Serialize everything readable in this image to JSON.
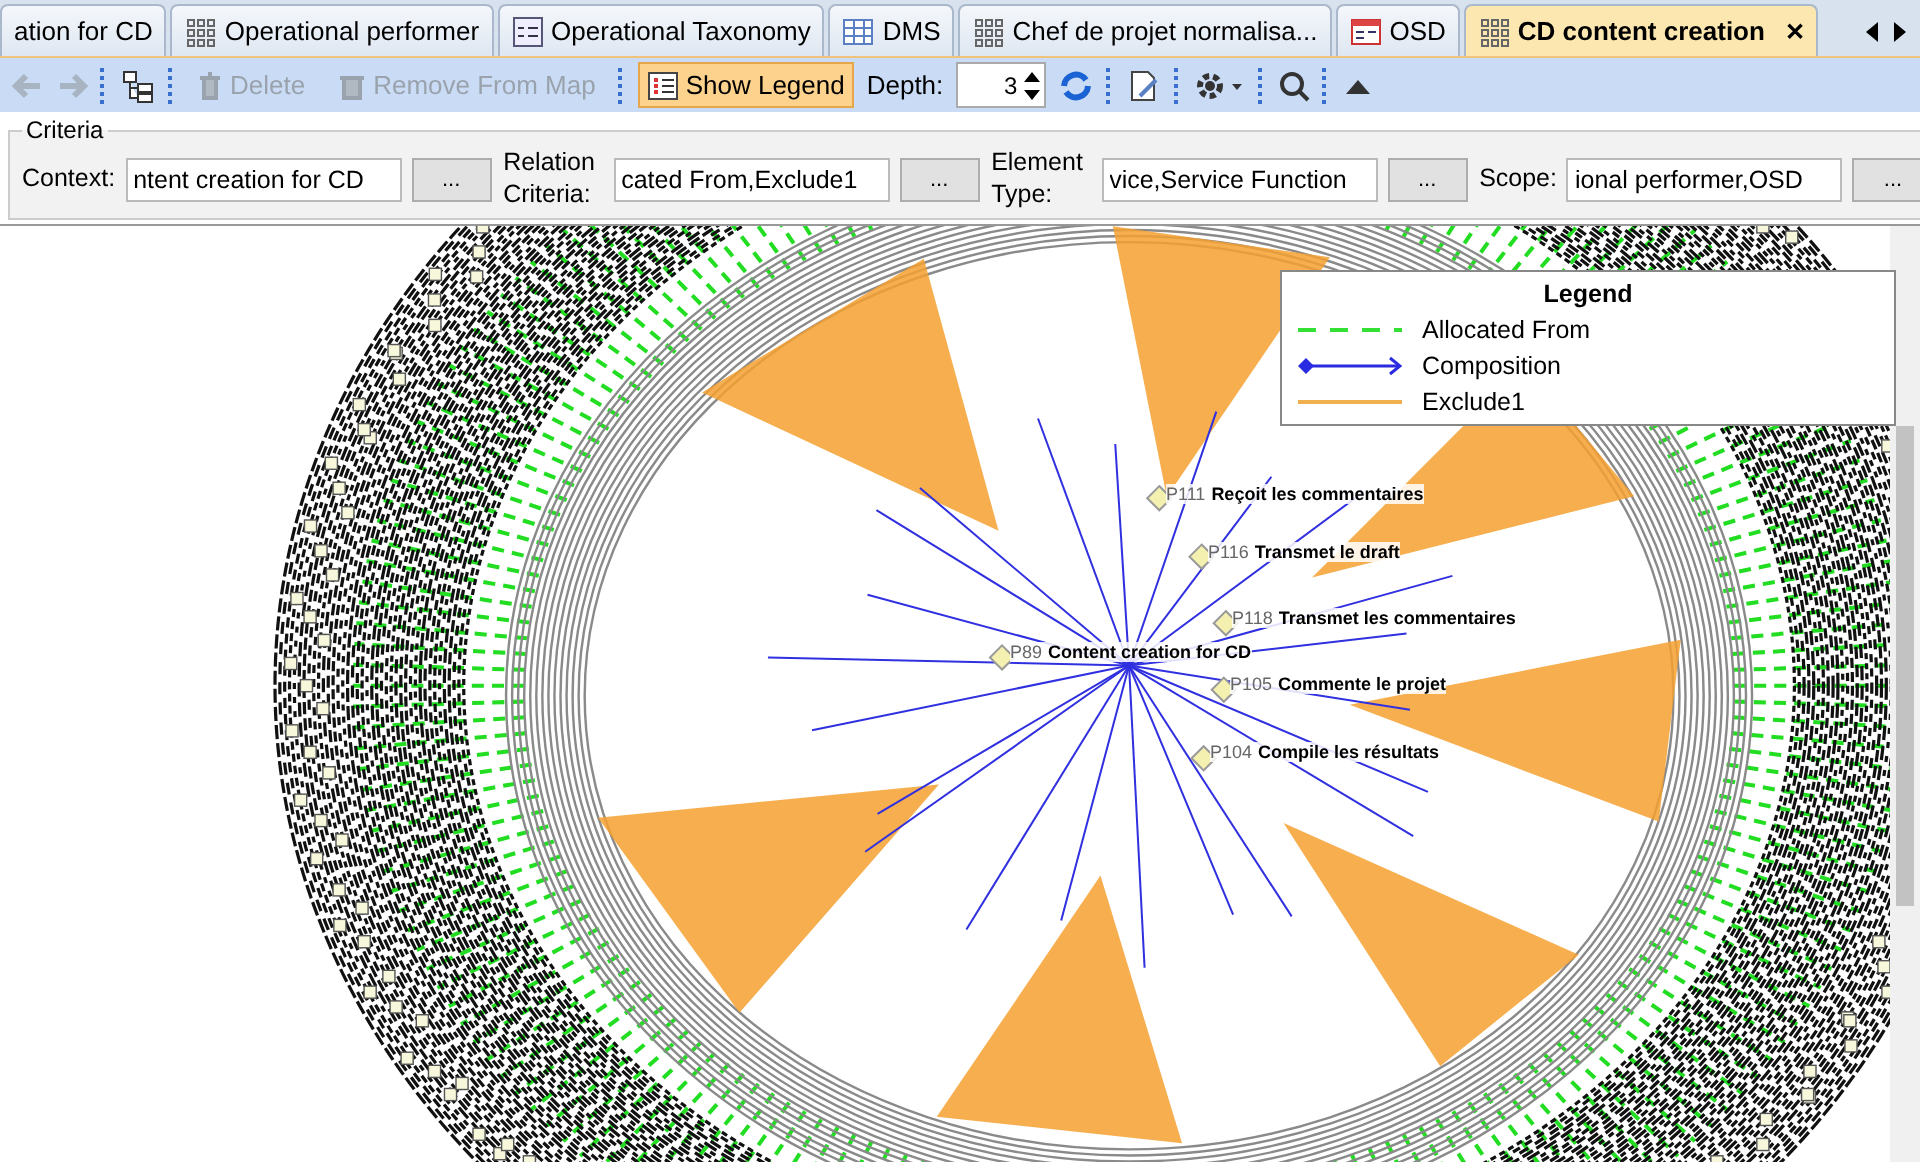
{
  "tabs": [
    {
      "label": "ation for CD",
      "selected": false
    },
    {
      "label": "Operational performer",
      "selected": false
    },
    {
      "label": "Operational Taxonomy",
      "selected": false
    },
    {
      "label": "DMS",
      "selected": false
    },
    {
      "label": "Chef de projet normalisa...",
      "selected": false
    },
    {
      "label": "OSD",
      "selected": false
    },
    {
      "label": "CD content creation",
      "selected": true,
      "close": "✕"
    }
  ],
  "toolbar": {
    "delete_label": "Delete",
    "remove_label": "Remove From Map",
    "legend_button": {
      "label": "Show Legend",
      "selected": true
    },
    "depth_label": "Depth:",
    "depth_value": "3"
  },
  "criteria": {
    "title": "Criteria",
    "fields": [
      {
        "label": "Context:",
        "value": "ntent creation for CD",
        "button": "..."
      },
      {
        "label": "Relation Criteria:",
        "value": "cated From,Exclude1",
        "button": "..."
      },
      {
        "label": "Element Type:",
        "value": "vice,Service Function",
        "button": "..."
      },
      {
        "label": "Scope:",
        "value": "ional performer,OSD",
        "button": "..."
      }
    ]
  },
  "legend": {
    "title": "Legend",
    "items": [
      {
        "label": "Allocated From",
        "kind": "dashed",
        "color": "#33e033"
      },
      {
        "label": "Composition",
        "kind": "composition",
        "color": "#2a2ae0"
      },
      {
        "label": "Exclude1",
        "kind": "solid",
        "color": "#f0b050"
      }
    ]
  },
  "graph": {
    "nodes": [
      {
        "id": "P89",
        "label": "Content creation for CD"
      },
      {
        "id": "P111",
        "label": "Reçoit les commentaires"
      },
      {
        "id": "P116",
        "label": "Transmet le draft"
      },
      {
        "id": "P118",
        "label": "Transmet les commentaires"
      },
      {
        "id": "P105",
        "label": "Commente le projet"
      },
      {
        "id": "P104",
        "label": "Compile les résultats"
      }
    ]
  }
}
